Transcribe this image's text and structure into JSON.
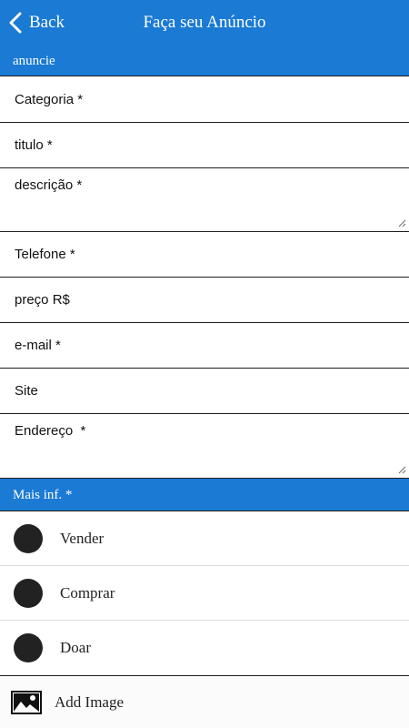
{
  "header": {
    "back_label": "Back",
    "title": "Faça seu Anúncio",
    "color": "#1a7ad4"
  },
  "section_top": {
    "label": "anuncie"
  },
  "fields": {
    "categoria": {
      "placeholder": "Categoria *",
      "value": ""
    },
    "titulo": {
      "placeholder": "titulo *",
      "value": ""
    },
    "descricao": {
      "placeholder": "descrição *",
      "value": ""
    },
    "telefone": {
      "placeholder": "Telefone *",
      "value": ""
    },
    "preco": {
      "placeholder": "preço R$",
      "value": ""
    },
    "email": {
      "placeholder": "e-mail *",
      "value": ""
    },
    "site": {
      "placeholder": "Site",
      "value": ""
    },
    "endereco": {
      "placeholder": "Endereço  *",
      "value": ""
    }
  },
  "section_mid": {
    "label": "Mais inf. *"
  },
  "options": [
    {
      "label": "Vender"
    },
    {
      "label": "Comprar"
    },
    {
      "label": "Doar"
    }
  ],
  "add_image": {
    "label": "Add Image",
    "icon": "image-icon"
  }
}
